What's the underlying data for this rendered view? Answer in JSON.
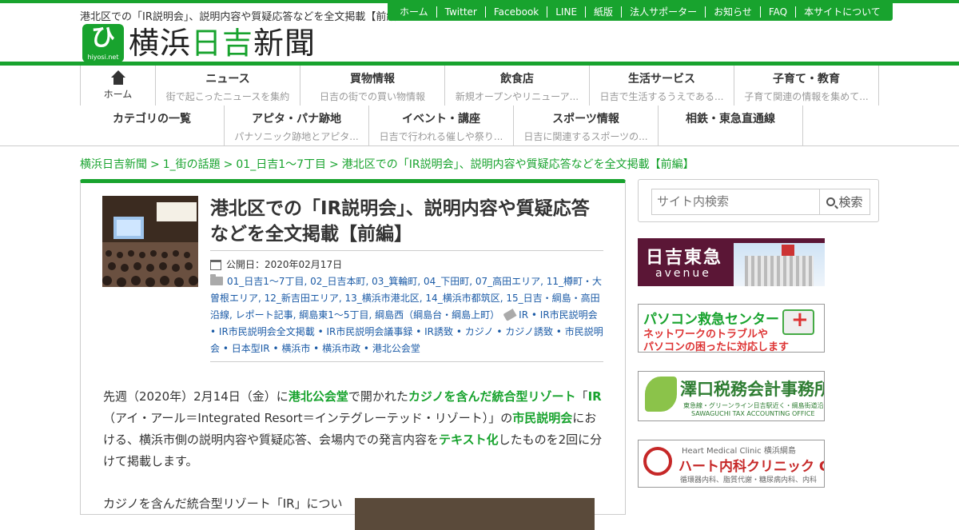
{
  "header": {
    "tagline": "港北区での「IR説明会」、説明内容や質疑応答などを全文掲載【前編】",
    "logo_mark": "ひ",
    "logo_domain": "hiyosi.net",
    "logo_text_1": "横浜",
    "logo_text_2": "日吉",
    "logo_text_3": "新聞",
    "topnav": [
      "ホーム",
      "Twitter",
      "Facebook",
      "LINE",
      "紙版",
      "法人サポーター",
      "お知らせ",
      "FAQ",
      "本サイトについて"
    ]
  },
  "nav": {
    "home_label": "ホーム",
    "row1": [
      {
        "title": "ニュース",
        "sub": "街で起こったニュースを集約"
      },
      {
        "title": "買物情報",
        "sub": "日吉の街での買い物情報"
      },
      {
        "title": "飲食店",
        "sub": "新規オープンやリニューア..."
      },
      {
        "title": "生活サービス",
        "sub": "日吉で生活するうえである..."
      },
      {
        "title": "子育て・教育",
        "sub": "子育て関連の情報を集めて..."
      }
    ],
    "row2": [
      {
        "title": "カテゴリの一覧",
        "sub": ""
      },
      {
        "title": "アピタ・パナ跡地",
        "sub": "パナソニック跡地とアピタ..."
      },
      {
        "title": "イベント・講座",
        "sub": "日吉で行われる催しや祭り..."
      },
      {
        "title": "スポーツ情報",
        "sub": "日吉に関連するスポーツの..."
      },
      {
        "title": "相鉄・東急直通線",
        "sub": ""
      }
    ]
  },
  "breadcrumb": {
    "items": [
      "横浜日吉新聞",
      "1_街の話題",
      "01_日吉1～7丁目",
      "港北区での「IR説明会」、説明内容や質疑応答などを全文掲載【前編】"
    ],
    "separator": ">"
  },
  "article": {
    "title": "港北区での「IR説明会」、説明内容や質疑応答などを全文掲載【前編】",
    "date": "公開日：2020年02月17日",
    "categories": "01_日吉1～7丁目, 02_日吉本町, 03_箕輪町, 04_下田町, 07_高田エリア, 11_樽町・大曽根エリア, 12_新吉田エリア, 13_横浜市港北区, 14_横浜市都筑区, 15_日吉・綱島・高田沿線, レポート記事, 綱島東1～5丁目, 綱島西（綱島台・綱島上町）",
    "tags": [
      "IR",
      "IR市民説明会",
      "IR市民説明会全文掲載",
      "IR市民説明会議事録",
      "IR誘致",
      "カジノ",
      "カジノ誘致",
      "市民説明会",
      "日本型IR",
      "横浜市",
      "横浜市政",
      "港北公会堂"
    ],
    "body": {
      "p1_a": "先週（2020年）2月14日（金）に",
      "p1_hl1": "港北公会堂",
      "p1_b": "で開かれた",
      "p1_hl2": "カジノを含んだ統合型リゾート",
      "p1_c": "「",
      "p1_hl3": "IR",
      "p1_d": "（アイ・アール＝Integrated Resort＝インテグレーテッド・リゾート）」の",
      "p1_hl4": "市民説明会",
      "p1_e": "における、横浜市側の説明内容や質疑応答、会場内での発言内容を",
      "p1_hl5": "テキスト化",
      "p1_f": "したものを2回に分けて掲載します。",
      "p2": "カジノを含んだ統合型リゾート「IR」につい"
    }
  },
  "sidebar": {
    "search_placeholder": "サイト内検索",
    "search_button": "検索",
    "banners": {
      "b1_t1": "日吉東急",
      "b1_t2": "avenue",
      "b2_t1": "パソコン救急センター",
      "b2_t2": "ネットワークのトラブルや",
      "b2_t3": "パソコンの困ったに対応します",
      "b3_t1": "澤口税務会計事務所",
      "b3_t2": "東急線・グリーンライン日吉駅近く・綱島街道沿い",
      "b3_t3": "SAWAGUCHI TAX ACCOUNTING OFFICE",
      "b4_t0": "Heart Medical Clinic  横浜綱島",
      "b4_t1": "ハート内科クリニック GeN",
      "b4_t2": "循環器内科、脂質代謝・糖尿病内科、内科"
    }
  },
  "colors": {
    "brand_green": "#18a32e",
    "link_blue": "#1a5aa6"
  }
}
